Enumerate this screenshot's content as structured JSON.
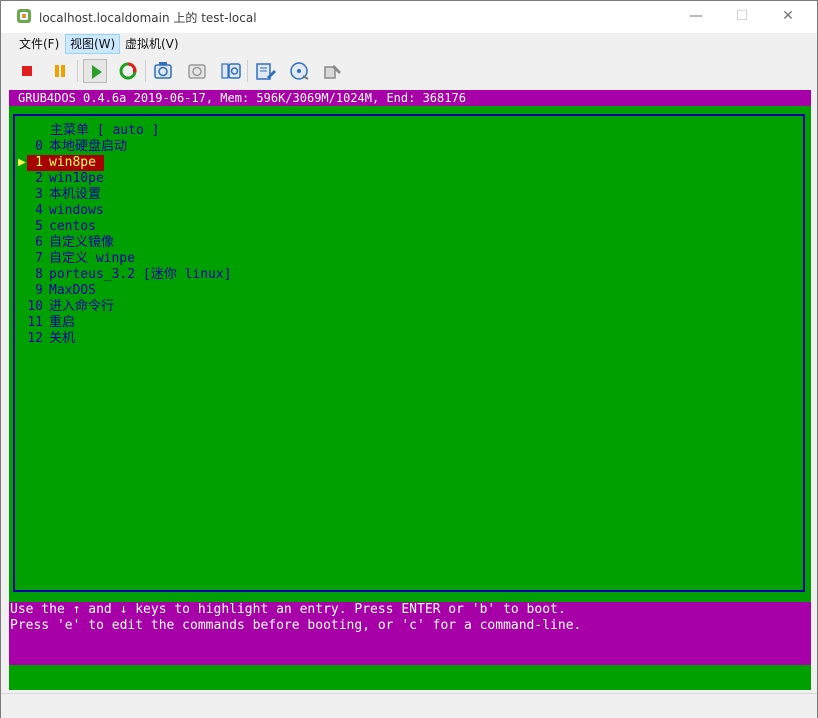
{
  "window": {
    "title": "localhost.localdomain 上的 test-local",
    "controls": {
      "minimize": "—",
      "maximize": "☐",
      "close": "✕"
    }
  },
  "menubar": {
    "items": [
      {
        "label": "文件(F)"
      },
      {
        "label": "视图(W)"
      },
      {
        "label": "虚拟机(V)"
      }
    ]
  },
  "toolbar": {
    "buttons": [
      {
        "icon": "stop-icon"
      },
      {
        "icon": "pause-icon"
      },
      {
        "icon": "play-icon"
      },
      {
        "icon": "reset-icon"
      },
      {
        "icon": "snapshot-icon"
      },
      {
        "icon": "revert-snapshot-icon"
      },
      {
        "icon": "manage-snapshots-icon"
      },
      {
        "icon": "vm-settings-icon"
      },
      {
        "icon": "cd-dvd-icon"
      },
      {
        "icon": "vm-tools-icon"
      }
    ]
  },
  "console": {
    "header": "GRUB4DOS 0.4.6a 2019-06-17, Mem: 596K/3069M/1024M, End: 368176",
    "menu_title": "主菜单 [ auto ]",
    "selected_index": 1,
    "entries": [
      {
        "num": "0",
        "label": "本地硬盘启动"
      },
      {
        "num": "1",
        "label": "win8pe"
      },
      {
        "num": "2",
        "label": "win10pe"
      },
      {
        "num": "3",
        "label": "本机设置"
      },
      {
        "num": "4",
        "label": "windows"
      },
      {
        "num": "5",
        "label": "centos"
      },
      {
        "num": "6",
        "label": "自定义镜像"
      },
      {
        "num": "7",
        "label": "自定义 winpe"
      },
      {
        "num": "8",
        "label": "porteus_3.2 [迷你 linux]"
      },
      {
        "num": "9",
        "label": "MaxDOS"
      },
      {
        "num": "10",
        "label": "进入命令行"
      },
      {
        "num": "11",
        "label": "重启"
      },
      {
        "num": "12",
        "label": "关机"
      }
    ],
    "help_lines": [
      "Use the ↑ and ↓ keys to highlight an entry. Press ENTER or 'b' to boot.",
      "Press 'e' to edit the commands before booting, or 'c' for a command-line."
    ],
    "colors": {
      "background": "#00a000",
      "bars": "#a800a8",
      "text": "#0000a8",
      "highlight": "#a80000",
      "highlight_text": "#ffff55"
    }
  }
}
